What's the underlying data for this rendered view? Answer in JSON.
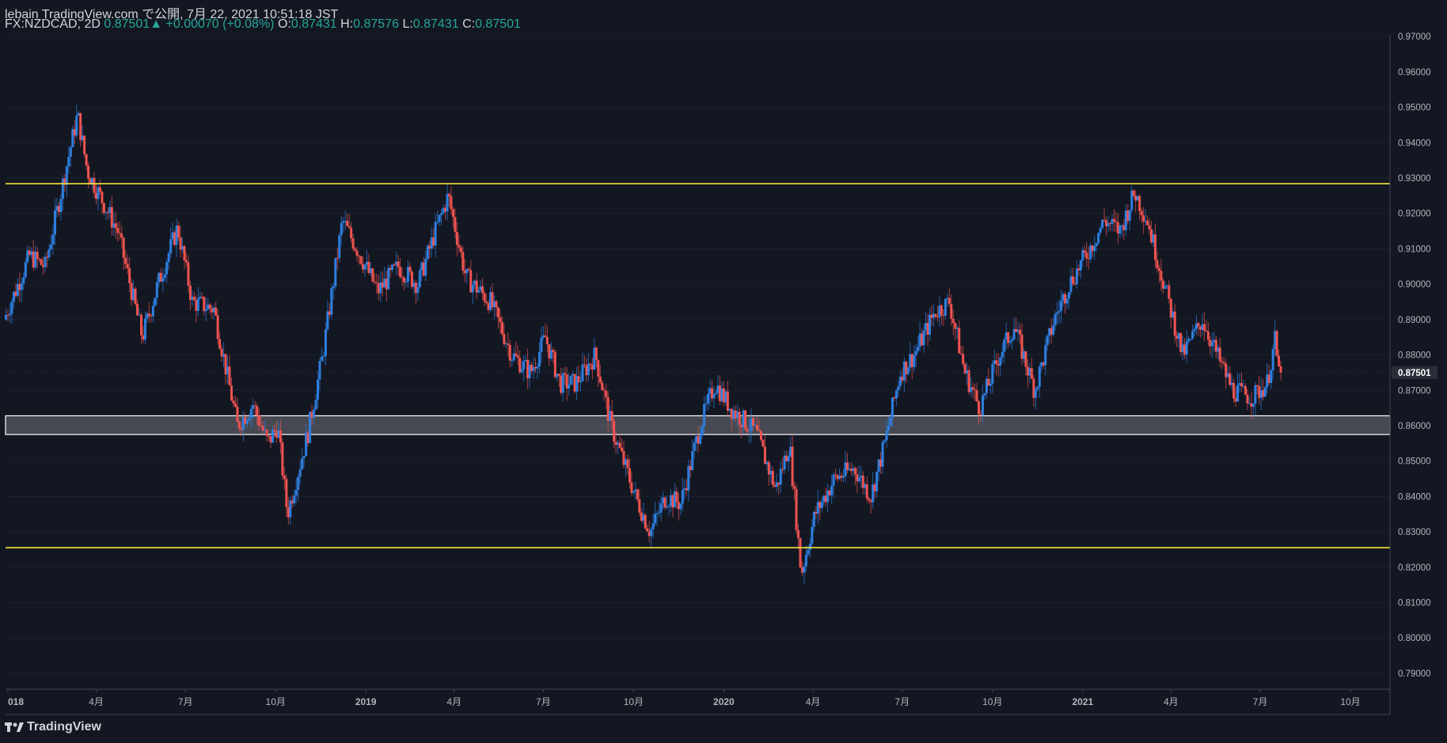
{
  "header": {
    "publisher_line": "lebain TradingView.com で公開, 7月 22, 2021 10:51:18 JST",
    "symbol": "FX:NZDCAD, 2D",
    "last": "0.87501",
    "change": "+0.00070 (+0.08%)",
    "o_label": "O:",
    "o_value": "0.87431",
    "h_label": "H:",
    "h_value": "0.87576",
    "l_label": "L:",
    "l_value": "0.87431",
    "c_label": "C:",
    "c_value": "0.87501"
  },
  "footer": {
    "brand": "TradingView"
  },
  "colors": {
    "background": "#131722",
    "up": "#2e7fe0",
    "down": "#ef5350",
    "level_line": "#f5e33b",
    "zone": "#ffffff",
    "axis_text": "#b2b5be",
    "price_tag_bg": "#2a2e39"
  },
  "chart_data": {
    "type": "candlestick",
    "symbol": "FX:NZDCAD",
    "interval": "2D",
    "y_axis": {
      "range": [
        0.7855,
        0.9705
      ],
      "ticks": [
        "0.97000",
        "0.96000",
        "0.95000",
        "0.94000",
        "0.93000",
        "0.92000",
        "0.91000",
        "0.90000",
        "0.89000",
        "0.88000",
        "0.87000",
        "0.86000",
        "0.85000",
        "0.84000",
        "0.83000",
        "0.82000",
        "0.81000",
        "0.80000",
        "0.79000"
      ],
      "current_price_label": "0.87501",
      "current_price": 0.87501
    },
    "x_axis": {
      "labels": [
        "018",
        "4月",
        "7月",
        "10月",
        "2019",
        "4月",
        "7月",
        "10月",
        "2020",
        "4月",
        "7月",
        "10月",
        "2021",
        "4月",
        "7月",
        "10月"
      ],
      "label_dates": [
        "2018-01-01",
        "2018-04-01",
        "2018-07-01",
        "2018-10-01",
        "2019-01-01",
        "2019-04-01",
        "2019-07-01",
        "2019-10-01",
        "2020-01-01",
        "2020-04-01",
        "2020-07-01",
        "2020-10-01",
        "2021-01-01",
        "2021-04-01",
        "2021-07-01",
        "2021-10-01"
      ]
    },
    "horizontal_lines": [
      {
        "price": 0.9284,
        "style": "yellow"
      },
      {
        "price": 0.8255,
        "style": "yellow"
      }
    ],
    "zone": {
      "top": 0.8628,
      "bottom": 0.8575
    },
    "price_path": [
      {
        "date": "2017-12-30",
        "price": 0.89
      },
      {
        "date": "2018-01-25",
        "price": 0.908
      },
      {
        "date": "2018-02-10",
        "price": 0.905
      },
      {
        "date": "2018-03-15",
        "price": 0.948
      },
      {
        "date": "2018-03-25",
        "price": 0.932
      },
      {
        "date": "2018-04-25",
        "price": 0.915
      },
      {
        "date": "2018-05-20",
        "price": 0.885
      },
      {
        "date": "2018-06-05",
        "price": 0.9
      },
      {
        "date": "2018-06-25",
        "price": 0.916
      },
      {
        "date": "2018-07-10",
        "price": 0.895
      },
      {
        "date": "2018-08-01",
        "price": 0.893
      },
      {
        "date": "2018-08-25",
        "price": 0.86
      },
      {
        "date": "2018-09-10",
        "price": 0.866
      },
      {
        "date": "2018-09-25",
        "price": 0.855
      },
      {
        "date": "2018-10-05",
        "price": 0.86
      },
      {
        "date": "2018-10-15",
        "price": 0.835
      },
      {
        "date": "2018-11-05",
        "price": 0.858
      },
      {
        "date": "2018-11-20",
        "price": 0.88
      },
      {
        "date": "2018-12-10",
        "price": 0.918
      },
      {
        "date": "2018-12-25",
        "price": 0.91
      },
      {
        "date": "2019-01-15",
        "price": 0.898
      },
      {
        "date": "2019-02-05",
        "price": 0.905
      },
      {
        "date": "2019-02-25",
        "price": 0.9
      },
      {
        "date": "2019-03-15",
        "price": 0.915
      },
      {
        "date": "2019-03-28",
        "price": 0.925
      },
      {
        "date": "2019-04-15",
        "price": 0.902
      },
      {
        "date": "2019-05-10",
        "price": 0.895
      },
      {
        "date": "2019-06-01",
        "price": 0.88
      },
      {
        "date": "2019-06-20",
        "price": 0.875
      },
      {
        "date": "2019-07-05",
        "price": 0.885
      },
      {
        "date": "2019-07-20",
        "price": 0.872
      },
      {
        "date": "2019-08-05",
        "price": 0.872
      },
      {
        "date": "2019-08-25",
        "price": 0.88
      },
      {
        "date": "2019-09-10",
        "price": 0.86
      },
      {
        "date": "2019-10-05",
        "price": 0.84
      },
      {
        "date": "2019-10-20",
        "price": 0.83
      },
      {
        "date": "2019-11-05",
        "price": 0.84
      },
      {
        "date": "2019-11-20",
        "price": 0.838
      },
      {
        "date": "2019-12-10",
        "price": 0.86
      },
      {
        "date": "2019-12-25",
        "price": 0.872
      },
      {
        "date": "2020-01-10",
        "price": 0.865
      },
      {
        "date": "2020-02-05",
        "price": 0.858
      },
      {
        "date": "2020-02-25",
        "price": 0.842
      },
      {
        "date": "2020-03-10",
        "price": 0.855
      },
      {
        "date": "2020-03-22",
        "price": 0.818
      },
      {
        "date": "2020-04-05",
        "price": 0.835
      },
      {
        "date": "2020-04-25",
        "price": 0.845
      },
      {
        "date": "2020-05-15",
        "price": 0.848
      },
      {
        "date": "2020-06-01",
        "price": 0.84
      },
      {
        "date": "2020-06-15",
        "price": 0.855
      },
      {
        "date": "2020-07-01",
        "price": 0.875
      },
      {
        "date": "2020-07-15",
        "price": 0.88
      },
      {
        "date": "2020-08-05",
        "price": 0.892
      },
      {
        "date": "2020-08-20",
        "price": 0.895
      },
      {
        "date": "2020-09-05",
        "price": 0.875
      },
      {
        "date": "2020-09-20",
        "price": 0.865
      },
      {
        "date": "2020-10-10",
        "price": 0.88
      },
      {
        "date": "2020-10-25",
        "price": 0.888
      },
      {
        "date": "2020-11-15",
        "price": 0.87
      },
      {
        "date": "2020-12-05",
        "price": 0.89
      },
      {
        "date": "2020-12-20",
        "price": 0.9
      },
      {
        "date": "2021-01-10",
        "price": 0.91
      },
      {
        "date": "2021-01-25",
        "price": 0.918
      },
      {
        "date": "2021-02-10",
        "price": 0.915
      },
      {
        "date": "2021-02-25",
        "price": 0.926
      },
      {
        "date": "2021-03-10",
        "price": 0.918
      },
      {
        "date": "2021-03-25",
        "price": 0.902
      },
      {
        "date": "2021-04-15",
        "price": 0.88
      },
      {
        "date": "2021-05-05",
        "price": 0.89
      },
      {
        "date": "2021-05-20",
        "price": 0.88
      },
      {
        "date": "2021-06-05",
        "price": 0.87
      },
      {
        "date": "2021-06-25",
        "price": 0.868
      },
      {
        "date": "2021-07-10",
        "price": 0.872
      },
      {
        "date": "2021-07-18",
        "price": 0.884
      },
      {
        "date": "2021-07-22",
        "price": 0.875
      }
    ]
  }
}
